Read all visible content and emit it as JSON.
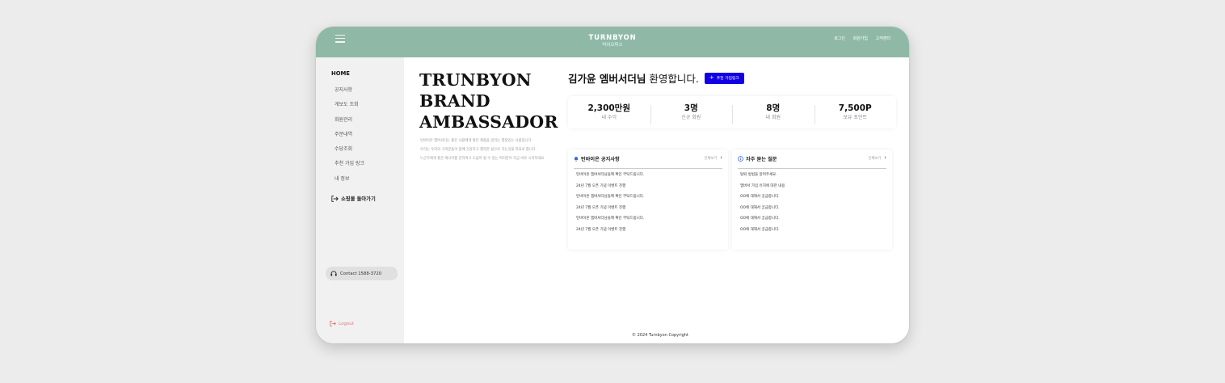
{
  "header": {
    "brand": "TURNBYON",
    "brand_sub": "마이오피스",
    "links": [
      "로그인",
      "회원가입",
      "고객센터"
    ]
  },
  "sidebar": {
    "home": "HOME",
    "items": [
      "공지사항",
      "게보도 조회",
      "회원관리",
      "주문내역",
      "수당조회",
      "추천 가입 링크",
      "내 정보"
    ],
    "back_shop": "쇼핑몰 돌아가기",
    "contact": "Contact 1588-3720",
    "logout": "Logout"
  },
  "hero": {
    "line1": "TRUNBYON",
    "line2": "BRAND",
    "line3": "AMBASSADOR",
    "desc": [
      "턴바이온 엠버서더는 좋은 사람에게 좋은 제품을 알리는 열정있는 사람입니다.",
      "우리는 우리의 고객분들이 함께 건강하고 행복한 삶으로 가는것을 목표로 합니다.",
      "누군가에게 좋은 에너지를 전하여고 도움이 될 수 있는 여러분이 지금 바로 시작하세요"
    ]
  },
  "welcome": {
    "name": "김가윤 엠버서더님",
    "suffix": " 환영합니다.",
    "button": "추천 가입링크"
  },
  "stats": [
    {
      "value": "2,300만원",
      "label": "내 수익"
    },
    {
      "value": "3명",
      "label": "신규 회원"
    },
    {
      "value": "8명",
      "label": "내 회원"
    },
    {
      "value": "7,500P",
      "label": "보유 포인트"
    }
  ],
  "notice": {
    "title": "턴바이온 공지사항",
    "more": "전체보기",
    "items": [
      "턴바이온 엠버서더님들께 확인 부탁드립니다.",
      "24년 7월 오픈 기념 이벤트 진행",
      "턴바이온 엠버서더님들께 확인 부탁드립니다.",
      "24년 7월 오픈 기념 이벤트 진행",
      "턴바이온 엠버서더님들께 확인 부탁드립니다.",
      "24년 7월 오픈 기념 이벤트 진행"
    ]
  },
  "faq": {
    "title": "자주 묻는 질문",
    "more": "전체보기",
    "items": [
      "탈퇴 방법을 알려주세요.",
      "엠버서 가입 유지에 대한 내용",
      "OO에 대해서 궁금합니다.",
      "OO에 대해서 궁금합니다.",
      "OO에 대해서 궁금합니다.",
      "OO에 대해서 궁금합니다."
    ]
  },
  "footer": {
    "copyright": "© 2024 Turnbyon Copyright"
  },
  "colors": {
    "header_bg": "#8fb9a6",
    "accent": "#1100e6",
    "sidebar_bg": "#f1f1f1",
    "logout": "#e07c7c"
  }
}
